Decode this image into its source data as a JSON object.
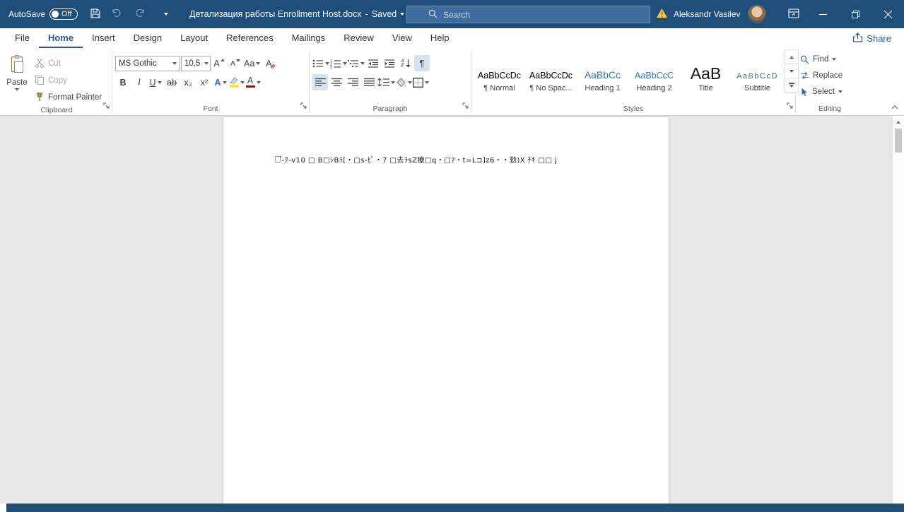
{
  "colors": {
    "titlebar_bg": "#1e4e79",
    "accent_blue": "#2b579a",
    "heading_blue": "#2e74b5",
    "warning_yellow": "#ffc83d",
    "font_color_red": "#c00000",
    "highlight_yellow": "#ffe438"
  },
  "titlebar": {
    "autosave_label": "AutoSave",
    "autosave_state": "Off",
    "document_title": "Детализация работы Enrollment Host.docx",
    "title_separator": "-",
    "save_status": "Saved",
    "search_placeholder": "Search",
    "user_name": "Aleksandr Vasilev"
  },
  "tabs": {
    "items": [
      "File",
      "Home",
      "Insert",
      "Design",
      "Layout",
      "References",
      "Mailings",
      "Review",
      "View",
      "Help"
    ],
    "active_tab": "Home",
    "share_label": "Share"
  },
  "ribbon": {
    "clipboard": {
      "group_label": "Clipboard",
      "paste_label": "Paste",
      "cut_label": "Cut",
      "copy_label": "Copy",
      "format_painter_label": "Format Painter"
    },
    "font": {
      "group_label": "Font",
      "font_name": "MS Gothic",
      "font_size": "10,5",
      "bold_label": "B",
      "italic_label": "I",
      "underline_label": "U",
      "strikethrough_label": "ab",
      "subscript_label": "x₂",
      "superscript_label": "x²",
      "change_case_label": "Aa",
      "grow_font_label": "A",
      "shrink_font_label": "A",
      "clear_formatting_label": "A",
      "text_effects_label": "A",
      "font_color_label": "A"
    },
    "paragraph": {
      "group_label": "Paragraph",
      "pilcrow_label": "¶",
      "sort_letter_a": "A",
      "sort_letter_z": "Z"
    },
    "styles": {
      "group_label": "Styles",
      "items": [
        {
          "preview": "AaBbCcDc",
          "name": "¶ Normal"
        },
        {
          "preview": "AaBbCcDc",
          "name": "¶ No Spac..."
        },
        {
          "preview": "AaBbCc",
          "name": "Heading 1"
        },
        {
          "preview": "AaBbCcC",
          "name": "Heading 2"
        },
        {
          "preview": "AaB",
          "name": "Title"
        },
        {
          "preview": "AaBbCcD",
          "name": "Subtitle"
        }
      ]
    },
    "editing": {
      "group_label": "Editing",
      "find_label": "Find",
      "replace_label": "Replace",
      "select_label": "Select"
    }
  },
  "document": {
    "line1": "□゚-ｸ-v10 □ B□ｼBﾗ[・□s-ﾋﾟ・7 □去ﾗsZ療□q・□?・t=L⊐]z6・・勁)X ﾁｷ □□ j"
  }
}
